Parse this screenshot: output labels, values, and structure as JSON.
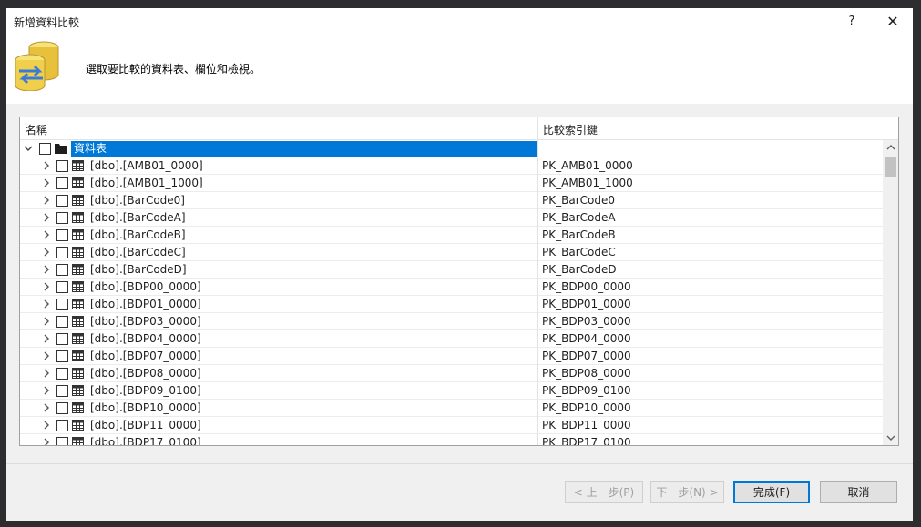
{
  "window": {
    "title": "新增資料比較",
    "help_label": "?",
    "close_label": "✕"
  },
  "header": {
    "instruction": "選取要比較的資料表、欄位和檢視。",
    "icon": "database-compare-icon"
  },
  "grid": {
    "columns": {
      "name": "名稱",
      "key": "比較索引鍵"
    },
    "root": {
      "label": "資料表",
      "expanded": true,
      "checked": false
    },
    "rows": [
      {
        "name": "[dbo].[AMB01_0000]",
        "key": "PK_AMB01_0000"
      },
      {
        "name": "[dbo].[AMB01_1000]",
        "key": "PK_AMB01_1000"
      },
      {
        "name": "[dbo].[BarCode0]",
        "key": "PK_BarCode0"
      },
      {
        "name": "[dbo].[BarCodeA]",
        "key": "PK_BarCodeA"
      },
      {
        "name": "[dbo].[BarCodeB]",
        "key": "PK_BarCodeB"
      },
      {
        "name": "[dbo].[BarCodeC]",
        "key": "PK_BarCodeC"
      },
      {
        "name": "[dbo].[BarCodeD]",
        "key": "PK_BarCodeD"
      },
      {
        "name": "[dbo].[BDP00_0000]",
        "key": "PK_BDP00_0000"
      },
      {
        "name": "[dbo].[BDP01_0000]",
        "key": "PK_BDP01_0000"
      },
      {
        "name": "[dbo].[BDP03_0000]",
        "key": "PK_BDP03_0000"
      },
      {
        "name": "[dbo].[BDP04_0000]",
        "key": "PK_BDP04_0000"
      },
      {
        "name": "[dbo].[BDP07_0000]",
        "key": "PK_BDP07_0000"
      },
      {
        "name": "[dbo].[BDP08_0000]",
        "key": "PK_BDP08_0000"
      },
      {
        "name": "[dbo].[BDP09_0100]",
        "key": "PK_BDP09_0100"
      },
      {
        "name": "[dbo].[BDP10_0000]",
        "key": "PK_BDP10_0000"
      },
      {
        "name": "[dbo].[BDP11_0000]",
        "key": "PK_BDP11_0000"
      },
      {
        "name": "[dbo].[BDP17_0100]",
        "key": "PK_BDP17_0100"
      }
    ]
  },
  "buttons": {
    "back": "< 上一步(P)",
    "next": "下一步(N) >",
    "finish": "完成(F)",
    "cancel": "取消"
  },
  "colors": {
    "selection": "#0078d7",
    "dialog_bg": "#f0f0f0"
  }
}
